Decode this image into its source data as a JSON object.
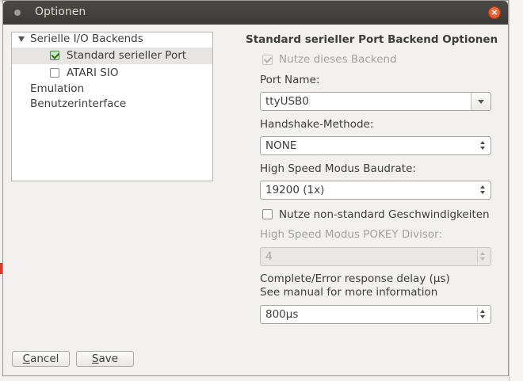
{
  "window": {
    "title": "Optionen"
  },
  "tree": {
    "items": [
      {
        "label": "Serielle I/O Backends",
        "level": 0,
        "expanded": true
      },
      {
        "label": "Standard serieller Port",
        "level": 1,
        "checked": true,
        "selected": true
      },
      {
        "label": "ATARI SIO",
        "level": 1,
        "checked": false
      },
      {
        "label": "Emulation",
        "level": 0
      },
      {
        "label": "Benutzerinterface",
        "level": 0
      }
    ]
  },
  "panel": {
    "title": "Standard serieller Port Backend Optionen",
    "use_backend": {
      "label": "Nutze dieses Backend",
      "checked": true,
      "disabled": true
    },
    "port_name": {
      "label": "Port Name:",
      "value": "ttyUSB0"
    },
    "handshake": {
      "label": "Handshake-Methode:",
      "value": "NONE"
    },
    "baudrate": {
      "label": "High Speed Modus Baudrate:",
      "value": "19200 (1x)"
    },
    "nonstandard": {
      "label": "Nutze non-standard Geschwindigkeiten",
      "checked": false
    },
    "pokey": {
      "label": "High Speed Modus POKEY Divisor:",
      "value": "4",
      "disabled": true
    },
    "delay": {
      "label_line1": "Complete/Error response delay (µs)",
      "label_line2": "See manual for more information",
      "value": "800µs"
    }
  },
  "buttons": {
    "cancel": {
      "mnemonic": "C",
      "rest": "ancel"
    },
    "save": {
      "mnemonic": "S",
      "rest": "ave"
    }
  },
  "colors": {
    "titlebar": "#3c3b37",
    "close": "#df4a16",
    "checked_green": "#4b8a3a"
  }
}
